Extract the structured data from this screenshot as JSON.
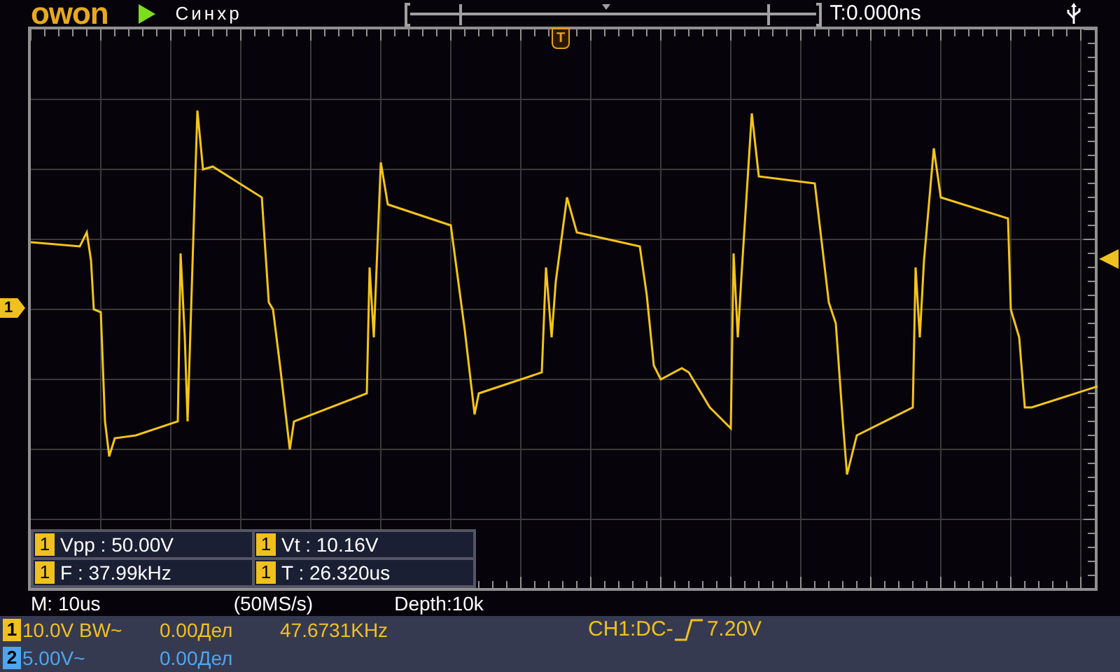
{
  "header": {
    "logo": "owon",
    "run_state": "Синхр",
    "time_offset": "T:0.000ns"
  },
  "markers": {
    "trigger_position": "T",
    "channel_1": "1"
  },
  "measurements": [
    {
      "channel": "1",
      "text": "Vpp : 50.00V"
    },
    {
      "channel": "1",
      "text": "Vt : 10.16V"
    },
    {
      "channel": "1",
      "text": "F : 37.99kHz"
    },
    {
      "channel": "1",
      "text": "T : 26.320us"
    }
  ],
  "acquisition": {
    "timebase": "M: 10us",
    "sample_rate": "(50MS/s)",
    "depth": "Depth:10k"
  },
  "channels": [
    {
      "number": "1",
      "color": "#f0c020",
      "scale": "10.0V BW~",
      "offset": "0.00Дел",
      "frequency": "47.6731KHz"
    },
    {
      "number": "2",
      "color": "#4ea6f0",
      "scale": "5.00V~",
      "offset": "0.00Дел"
    }
  ],
  "trigger": {
    "source": "CH1:DC-",
    "level": "7.20V"
  }
}
